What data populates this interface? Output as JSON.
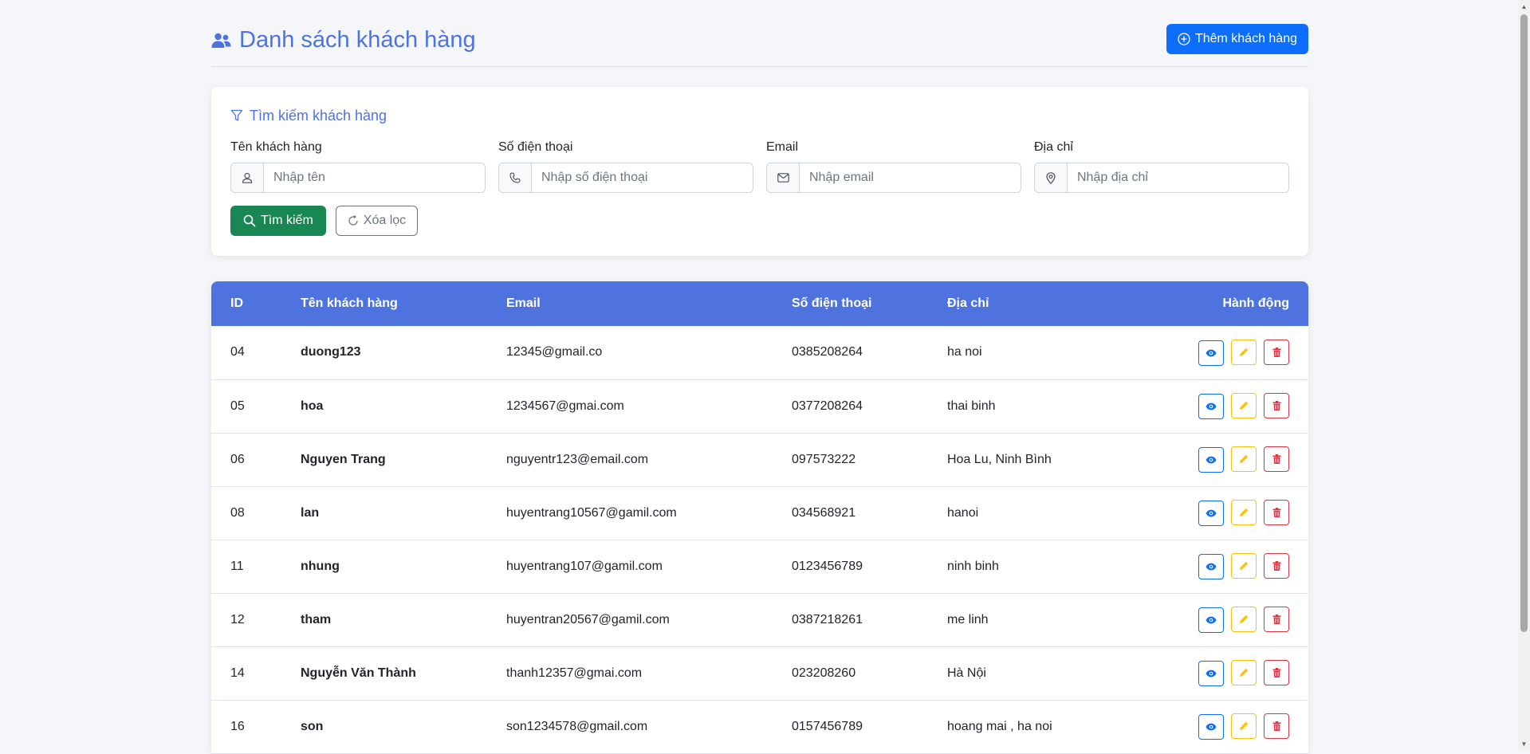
{
  "header": {
    "title": "Danh sách khách hàng",
    "add_button": "Thêm khách hàng"
  },
  "search": {
    "title": "Tìm kiếm khách hàng",
    "fields": [
      {
        "label": "Tên khách hàng",
        "placeholder": "Nhập tên",
        "value": ""
      },
      {
        "label": "Số điện thoại",
        "placeholder": "Nhập số điện thoại",
        "value": ""
      },
      {
        "label": "Email",
        "placeholder": "Nhập email",
        "value": ""
      },
      {
        "label": "Địa chỉ",
        "placeholder": "Nhập địa chỉ",
        "value": ""
      }
    ],
    "search_button": "Tìm kiếm",
    "clear_button": "Xóa lọc"
  },
  "table": {
    "headers": {
      "id": "ID",
      "name": "Tên khách hàng",
      "email": "Email",
      "phone": "Số điện thoại",
      "address": "Địa chỉ",
      "actions": "Hành động"
    },
    "rows": [
      {
        "id": "04",
        "name": "duong123",
        "email": "12345@gmail.co",
        "phone": "0385208264",
        "address": "ha noi"
      },
      {
        "id": "05",
        "name": "hoa",
        "email": "1234567@gmai.com",
        "phone": "0377208264",
        "address": "thai binh"
      },
      {
        "id": "06",
        "name": "Nguyen Trang",
        "email": "nguyentr123@email.com",
        "phone": "097573222",
        "address": "Hoa Lu, Ninh Bình"
      },
      {
        "id": "08",
        "name": "lan",
        "email": "huyentrang10567@gamil.com",
        "phone": "034568921",
        "address": "hanoi"
      },
      {
        "id": "11",
        "name": "nhung",
        "email": "huyentrang107@gamil.com",
        "phone": "0123456789",
        "address": "ninh binh"
      },
      {
        "id": "12",
        "name": "tham",
        "email": "huyentran20567@gamil.com",
        "phone": "0387218261",
        "address": "me linh"
      },
      {
        "id": "14",
        "name": "Nguyễn Văn Thành",
        "email": "thanh12357@gmai.com",
        "phone": "023208260",
        "address": "Hà Nội"
      },
      {
        "id": "16",
        "name": "son",
        "email": "son1234578@gmail.com",
        "phone": "0157456789",
        "address": "hoang mai , ha noi"
      }
    ]
  },
  "icons": {
    "title": "users-icon",
    "add": "plus-circle-icon",
    "filter": "funnel-icon",
    "view": "eye-icon",
    "edit": "pencil-icon",
    "delete": "trash-icon"
  },
  "colors": {
    "primary": "#4e73df",
    "add_button": "#0d6efd",
    "search_button": "#198754",
    "view": "#0d6efd",
    "edit": "#ffc107",
    "delete": "#dc3545"
  }
}
